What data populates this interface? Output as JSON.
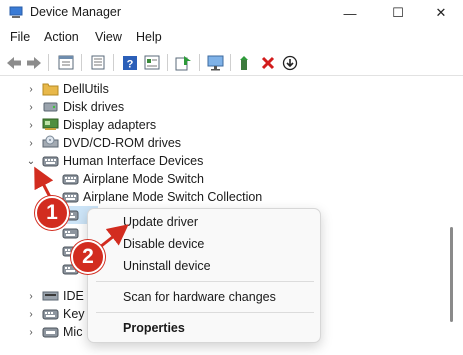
{
  "window": {
    "title": "Device Manager",
    "minimize_glyph": "—",
    "maximize_glyph": "☐",
    "close_glyph": "✕"
  },
  "menu": {
    "file": "File",
    "action": "Action",
    "view": "View",
    "help": "Help"
  },
  "toolbar_icons": [
    "back-icon",
    "forward-icon",
    "properties-icon",
    "list-icon",
    "help-icon",
    "details-icon",
    "update-icon",
    "monitor-icon",
    "add-driver-icon",
    "uninstall-icon",
    "disable-icon"
  ],
  "tree": {
    "dellutils": "DellUtils",
    "disk_drives": "Disk drives",
    "display_adapters": "Display adapters",
    "dvd_drives": "DVD/CD-ROM drives",
    "hid": "Human Interface Devices",
    "airplane_switch": "Airplane Mode Switch",
    "airplane_collection": "Airplane Mode Switch Collection",
    "ide_partial": "IDE",
    "key_partial": "Key",
    "mic_partial": "Mic"
  },
  "context_menu": {
    "update_driver": "Update driver",
    "disable_device": "Disable device",
    "uninstall_device": "Uninstall device",
    "scan": "Scan for hardware changes",
    "properties": "Properties"
  },
  "annotations": {
    "step1": "1",
    "step2": "2",
    "color": "#d22c1f"
  }
}
